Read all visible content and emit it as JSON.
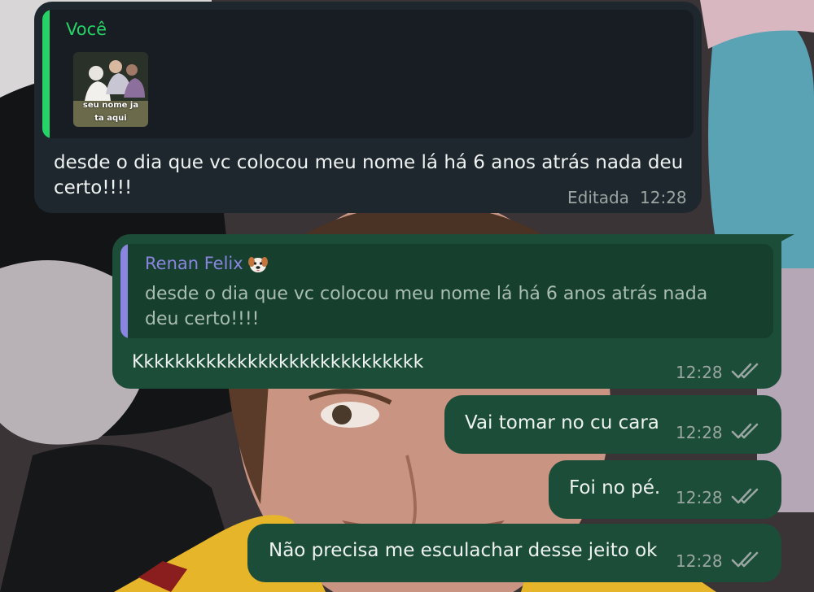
{
  "colors": {
    "incoming_bubble": "#1f272e",
    "outgoing_bubble": "#1b4d38",
    "self_name": "#25d366",
    "other_name": "#8a85e0"
  },
  "message1": {
    "quote_author": "Você",
    "sticker_text_line1": "seu nome ja",
    "sticker_text_line2": "ta aqui",
    "text_line1": "desde o dia que vc colocou meu nome lá há 6 anos atrás nada deu",
    "text_line2": "certo!!!!",
    "edited_label": "Editada",
    "time": "12:28"
  },
  "message2": {
    "quote_author": "Renan Felix",
    "quote_author_emoji_icon": "dog-face-icon",
    "quote_line1": "desde o dia que vc colocou meu nome lá há 6 anos atrás nada",
    "quote_line2": "deu certo!!!!",
    "text": "Kkkkkkkkkkkkkkkkkkkkkkkkkkkk",
    "time": "12:28",
    "status_icon": "double-check-icon"
  },
  "message3": {
    "text": "Vai tomar no cu cara",
    "time": "12:28",
    "status_icon": "double-check-icon"
  },
  "message4": {
    "text": "Foi no pé.",
    "time": "12:28",
    "status_icon": "double-check-icon"
  },
  "message5": {
    "text": "Não precisa me esculachar desse jeito ok",
    "time": "12:28",
    "status_icon": "double-check-icon"
  }
}
